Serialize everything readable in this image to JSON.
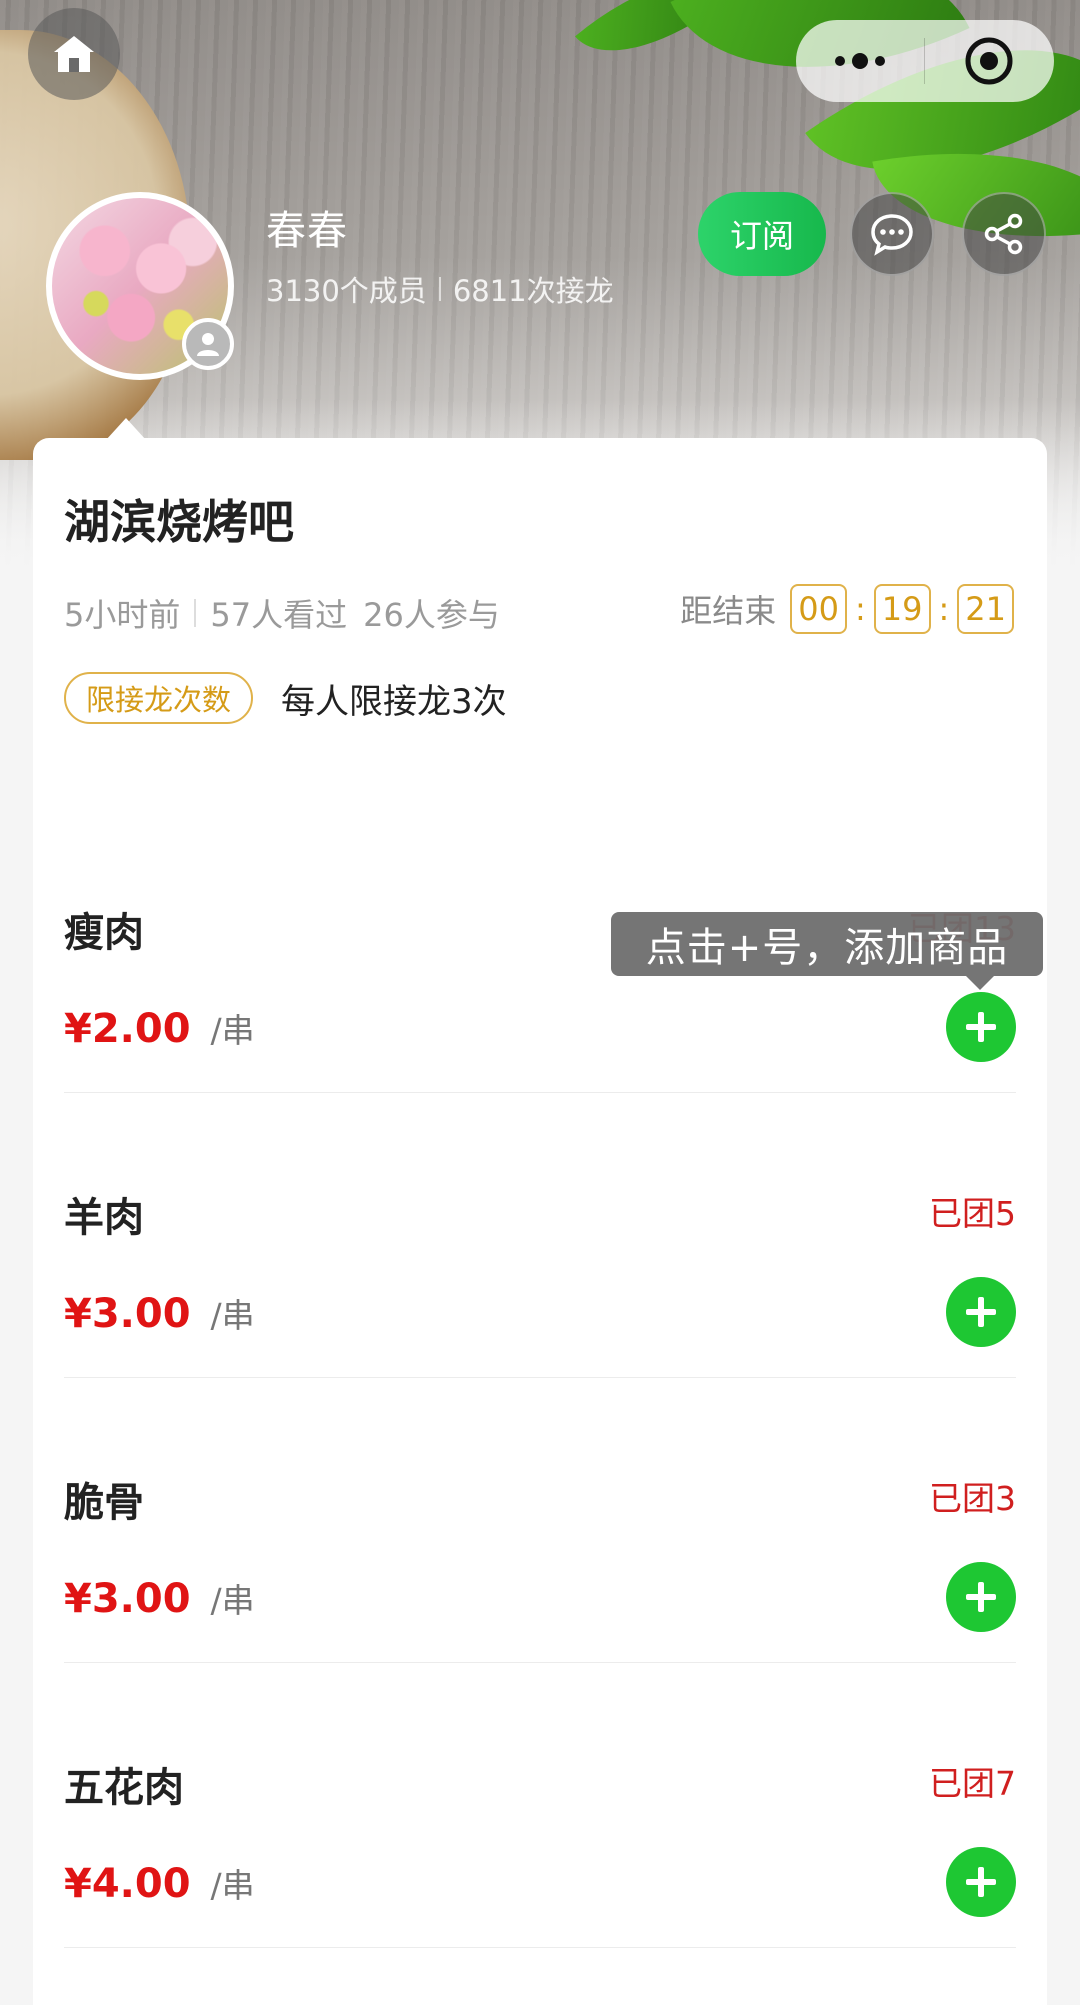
{
  "header": {
    "profile_name": "春春",
    "members": "3130个成员",
    "joins": "6811次接龙",
    "subscribe_label": "订阅"
  },
  "group": {
    "title": "湖滨烧烤吧",
    "posted": "5小时前",
    "viewed": "57人看过",
    "participated": "26人参与",
    "countdown_label": "距结束",
    "countdown": {
      "hours": "00",
      "minutes": "19",
      "seconds": "21"
    },
    "limit_tag": "限接龙次数",
    "limit_text": "每人限接龙3次"
  },
  "tooltip": "点击+号，添加商品",
  "items": [
    {
      "name": "瘦肉",
      "joined": "已团13",
      "price": "¥2.00",
      "unit": "/串"
    },
    {
      "name": "羊肉",
      "joined": "已团5",
      "price": "¥3.00",
      "unit": "/串"
    },
    {
      "name": "脆骨",
      "joined": "已团3",
      "price": "¥3.00",
      "unit": "/串"
    },
    {
      "name": "五花肉",
      "joined": "已团7",
      "price": "¥4.00",
      "unit": "/串"
    }
  ],
  "colors": {
    "accent_green": "#1ec733",
    "price_red": "#e01414",
    "gold": "#d59b17"
  },
  "icons": [
    "home-icon",
    "more-icon",
    "target-icon",
    "user-icon",
    "chat-icon",
    "share-icon",
    "plus-icon"
  ]
}
